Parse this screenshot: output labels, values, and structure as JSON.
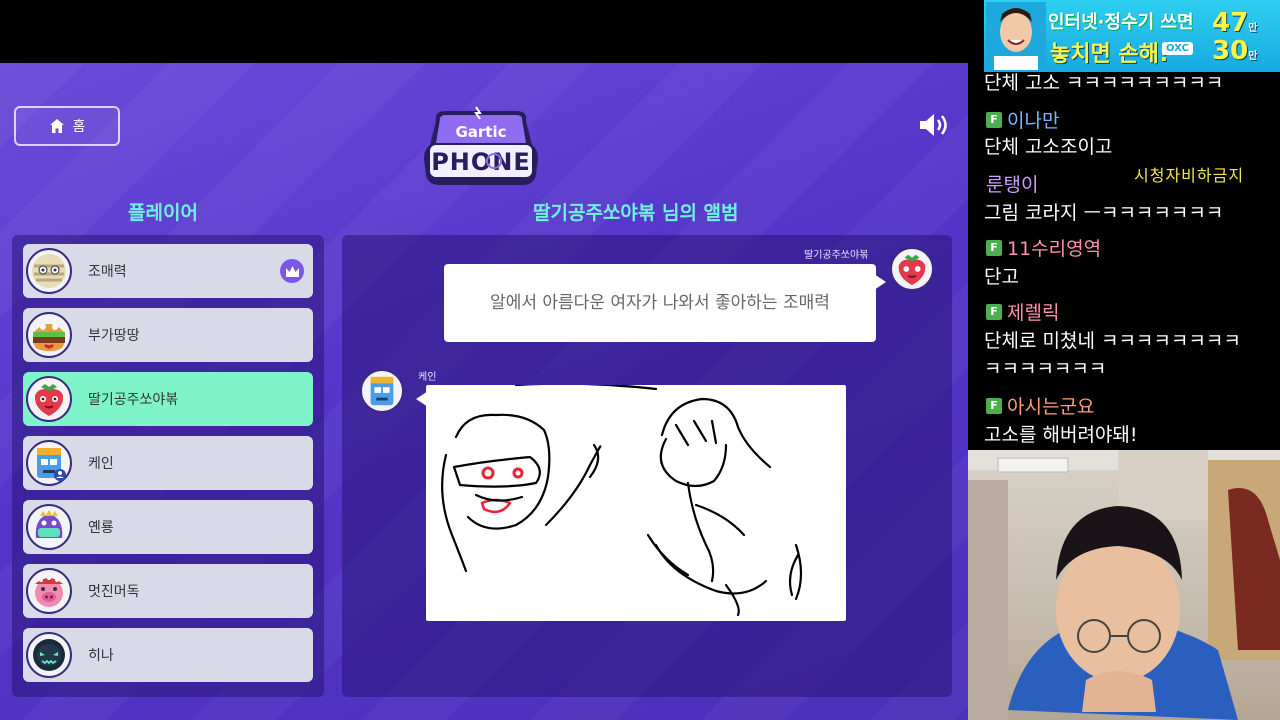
{
  "game": {
    "home_label": "홈",
    "logo_top": "Gartic",
    "logo_bottom": "PHONE",
    "players_title": "플레이어",
    "album_title": "딸기공주쏘야볶 님의 앨범"
  },
  "players": [
    {
      "name": "조매력",
      "host": true,
      "active": false,
      "avatar": "mummy-avatar-icon"
    },
    {
      "name": "부가땅땅",
      "host": false,
      "active": false,
      "avatar": "burger-avatar-icon"
    },
    {
      "name": "딸기공주쏘야볶",
      "host": false,
      "active": true,
      "avatar": "strawberry-avatar-icon"
    },
    {
      "name": "케인",
      "host": false,
      "active": false,
      "avatar": "robot-avatar-icon"
    },
    {
      "name": "옌룡",
      "host": false,
      "active": false,
      "avatar": "dinosaur-avatar-icon"
    },
    {
      "name": "멋진머독",
      "host": false,
      "active": false,
      "avatar": "pig-avatar-icon"
    },
    {
      "name": "히나",
      "host": false,
      "active": false,
      "avatar": "ghost-avatar-icon"
    }
  ],
  "album": {
    "text_author": "딸기공주쏘야볶",
    "text_entry": "알에서 아름다운 여자가 나와서 좋아하는 조매력",
    "drawing_author": "케인"
  },
  "ad": {
    "line1": "인터넷·정수기 쓰면",
    "line2": "놓치면 손해!",
    "badge": "OXC",
    "price1": "47",
    "price2": "30",
    "unit": "만"
  },
  "chat": {
    "messages": [
      {
        "user": "",
        "text": "단체 고소 ㅋㅋㅋㅋㅋㅋㅋㅋㅋ"
      },
      {
        "user": "이나만",
        "text": "단체 고소조이고",
        "user_color": "#7ab8ff"
      },
      {
        "user": "룬탱이",
        "text": "그림 코라지 ㅡㅋㅋㅋㅋㅋㅋㅋ",
        "user_color": "#c9a0ff"
      },
      {
        "user": "11수리영역",
        "text": "단고",
        "user_color": "#ff8fb0"
      },
      {
        "user": "제렐릭",
        "text": "단체로 미쳤네 ㅋㅋㅋㅋㅋㅋㅋㅋ",
        "text2": "ㅋㅋㅋㅋㅋㅋㅋ",
        "user_color": "#ff8fb0"
      },
      {
        "user": "아시는군요",
        "text": "고소를 해버려야돼!",
        "user_color": "#ff9f7a"
      }
    ],
    "overlay": "시청자비하금지"
  }
}
